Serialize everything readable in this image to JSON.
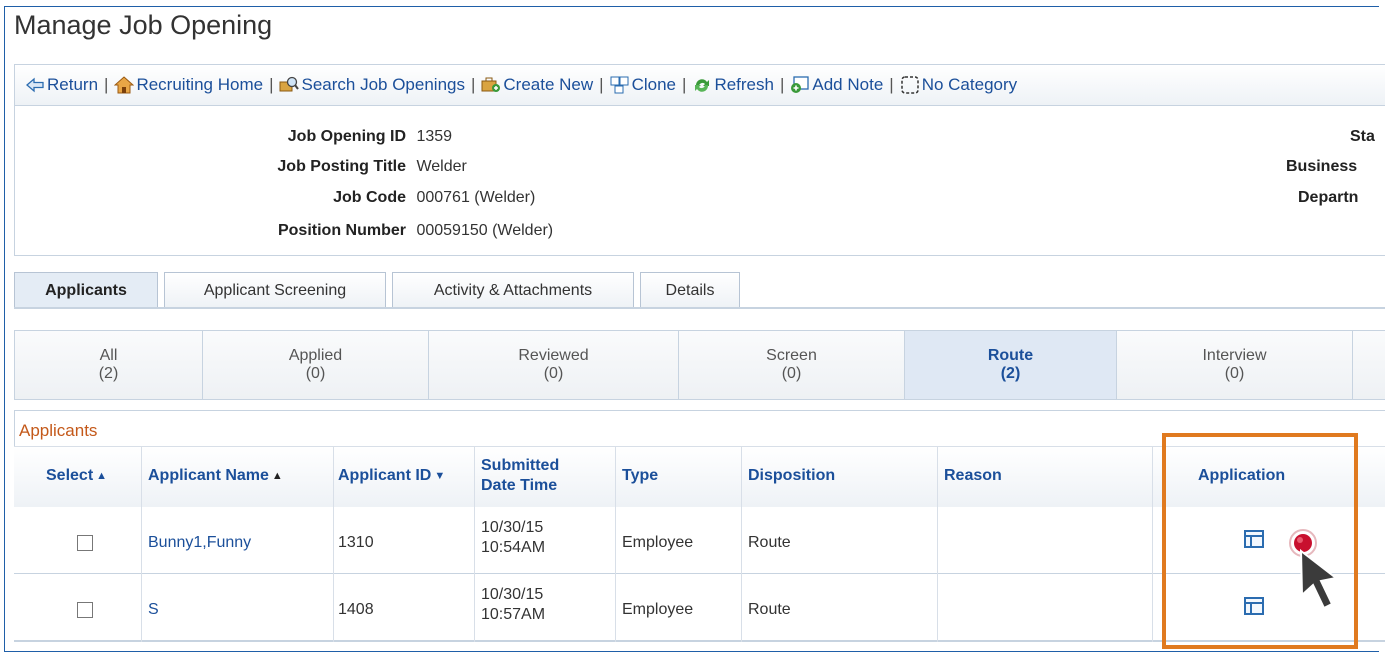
{
  "page": {
    "title": "Manage Job Opening"
  },
  "toolbar": {
    "items": [
      {
        "label": "Return",
        "icon": "return-arrow-icon"
      },
      {
        "label": "Recruiting Home",
        "icon": "home-icon"
      },
      {
        "label": "Search Job Openings",
        "icon": "search-job-icon"
      },
      {
        "label": "Create New",
        "icon": "create-new-icon"
      },
      {
        "label": "Clone",
        "icon": "clone-icon"
      },
      {
        "label": "Refresh",
        "icon": "refresh-icon"
      },
      {
        "label": "Add Note",
        "icon": "add-note-icon"
      },
      {
        "label": "No Category",
        "icon": "category-icon"
      }
    ]
  },
  "info": {
    "left": [
      {
        "label": "Job Opening ID",
        "value": "1359"
      },
      {
        "label": "Job Posting Title",
        "value": "Welder"
      },
      {
        "label": "Job Code",
        "value": "000761 (Welder)"
      },
      {
        "label": "Position Number",
        "value": "00059150 (Welder)"
      }
    ],
    "right": [
      {
        "label": "Sta"
      },
      {
        "label": "Business"
      },
      {
        "label": "Departn"
      }
    ]
  },
  "tabs": [
    {
      "label": "Applicants",
      "active": true
    },
    {
      "label": "Applicant Screening"
    },
    {
      "label": "Activity & Attachments"
    },
    {
      "label": "Details"
    }
  ],
  "steps": [
    {
      "label": "All",
      "count": "(2)"
    },
    {
      "label": "Applied",
      "count": "(0)"
    },
    {
      "label": "Reviewed",
      "count": "(0)"
    },
    {
      "label": "Screen",
      "count": "(0)"
    },
    {
      "label": "Route",
      "count": "(2)",
      "active": true
    },
    {
      "label": "Interview",
      "count": "(0)"
    }
  ],
  "grid": {
    "title": "Applicants",
    "columns": {
      "select": "Select",
      "name": "Applicant Name",
      "id": "Applicant ID",
      "submitted_line1": "Submitted",
      "submitted_line2": "Date Time",
      "type": "Type",
      "disposition": "Disposition",
      "reason": "Reason",
      "application": "Application"
    },
    "rows": [
      {
        "name": "Bunny1,Funny",
        "id": "1310",
        "date": "10/30/15",
        "time": "10:54AM",
        "type": "Employee",
        "disposition": "Route",
        "reason": ""
      },
      {
        "name": "S",
        "id": "1408",
        "date": "10/30/15",
        "time": "10:57AM",
        "type": "Employee",
        "disposition": "Route",
        "reason": ""
      }
    ]
  },
  "colors": {
    "link": "#1b4f9a",
    "highlight": "#e07a1f",
    "section_title": "#c4591a",
    "click_marker": "#c8102e"
  }
}
